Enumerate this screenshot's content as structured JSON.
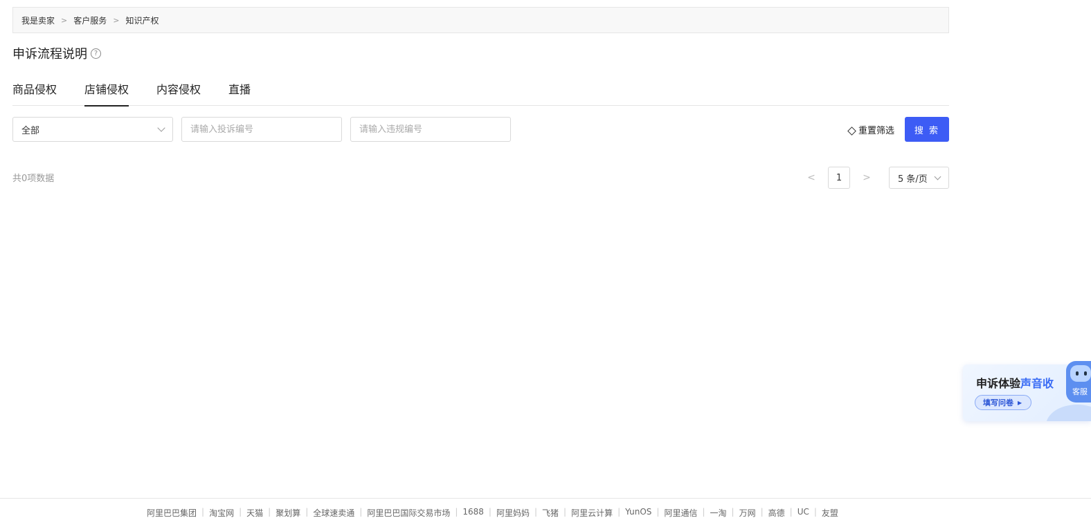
{
  "breadcrumb": [
    "我是卖家",
    "客户服务",
    "知识产权"
  ],
  "breadcrumb_sep": ">",
  "page_title": "申诉流程说明",
  "help_glyph": "?",
  "tabs": [
    {
      "label": "商品侵权",
      "active": false
    },
    {
      "label": "店铺侵权",
      "active": true
    },
    {
      "label": "内容侵权",
      "active": false
    },
    {
      "label": "直播",
      "active": false
    }
  ],
  "filters": {
    "type_select": "全部",
    "complaint_placeholder": "请输入投诉编号",
    "violation_placeholder": "请输入违规编号",
    "reset_label": "重置筛选",
    "search_label": "搜 索"
  },
  "total_text": "共0项数据",
  "pagination": {
    "prev": "<",
    "current": "1",
    "next": ">",
    "page_size": "5 条/页"
  },
  "survey": {
    "title_prefix": "申诉体验",
    "title_highlight": "声音收",
    "button_label": "填写问卷",
    "button_arrow": "▶",
    "robot_label": "客服"
  },
  "footer_links": [
    "阿里巴巴集团",
    "淘宝网",
    "天猫",
    "聚划算",
    "全球速卖通",
    "阿里巴巴国际交易市场",
    "1688",
    "阿里妈妈",
    "飞猪",
    "阿里云计算",
    "YunOS",
    "阿里通信",
    "一淘",
    "万网",
    "高德",
    "UC",
    "友盟"
  ],
  "footer_sep": "|",
  "colors": {
    "primary": "#3d5cf5",
    "survey_accent": "#3a6cf5"
  }
}
